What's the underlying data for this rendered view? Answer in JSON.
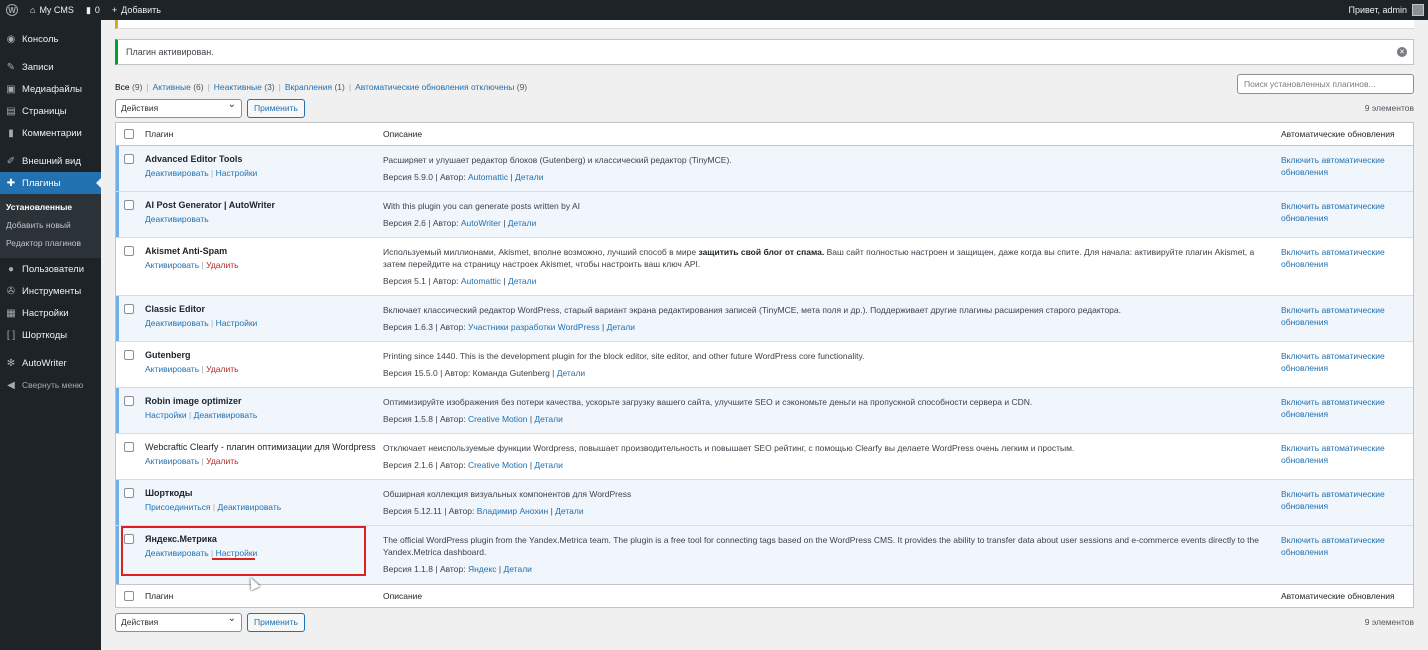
{
  "adminbar": {
    "site_name": "My CMS",
    "comments_count": "0",
    "add_new": "Добавить",
    "greeting": "Привет, admin"
  },
  "sidebar": {
    "items": [
      {
        "label": "Консоль",
        "icon": "dashboard-icon"
      },
      {
        "label": "Записи",
        "icon": "pin-icon"
      },
      {
        "label": "Медиафайлы",
        "icon": "media-icon"
      },
      {
        "label": "Страницы",
        "icon": "page-icon"
      },
      {
        "label": "Комментарии",
        "icon": "comment-icon"
      },
      {
        "label": "Внешний вид",
        "icon": "brush-icon"
      },
      {
        "label": "Плагины",
        "icon": "plugin-icon"
      },
      {
        "label": "Пользователи",
        "icon": "user-icon"
      },
      {
        "label": "Инструменты",
        "icon": "wrench-icon"
      },
      {
        "label": "Настройки",
        "icon": "settings-icon"
      },
      {
        "label": "Шорткоды",
        "icon": "brackets-icon"
      },
      {
        "label": "AutoWriter",
        "icon": "gear-icon"
      },
      {
        "label": "Свернуть меню",
        "icon": "collapse-icon"
      }
    ],
    "submenu": [
      "Установленные",
      "Добавить новый",
      "Редактор плагинов"
    ]
  },
  "notice": {
    "text": "Плагин активирован."
  },
  "filters": {
    "all": "Все",
    "all_count": "(9)",
    "active": "Активные",
    "active_count": "(6)",
    "inactive": "Неактивные",
    "inactive_count": "(3)",
    "dropins": "Вкрапления",
    "dropins_count": "(1)",
    "autoupdates": "Автоматические обновления отключены",
    "autoupdates_count": "(9)"
  },
  "search": {
    "placeholder": "Поиск установленных плагинов..."
  },
  "bulk": {
    "select": "Действия",
    "apply": "Применить",
    "count": "9 элементов"
  },
  "table": {
    "col_plugin": "Плагин",
    "col_desc": "Описание",
    "col_auto": "Автоматические обновления",
    "auto_label": "Включить автоматические обновления",
    "rows": [
      {
        "name": "Advanced Editor Tools",
        "actions": [
          "Деактивировать",
          "Настройки"
        ],
        "desc": "Расширяет и улушает редактор блоков (Gutenberg) и классический редактор (TinyMCE).",
        "version": "Версия 5.9.0",
        "author_prefix": "Автор:",
        "author": "Automattic",
        "details": "Детали"
      },
      {
        "name": "AI Post Generator | AutoWriter",
        "actions": [
          "Деактивировать"
        ],
        "desc": "With this plugin you can generate posts written by AI",
        "version": "Версия 2.6",
        "author_prefix": "Автор:",
        "author": "AutoWriter",
        "details": "Детали"
      },
      {
        "name": "Akismet Anti-Spam",
        "actions": [
          "Активировать",
          "Удалить"
        ],
        "desc_a": "Используемый миллионами, Akismet, вполне возможно, лучший способ в мире",
        "desc_b": "защитить свой блог от спама.",
        "desc_c": "Ваш сайт полностью настроен и защищен, даже когда вы спите. Для начала: активируйте плагин Akismet, а затем перейдите на страницу настроек Akismet, чтобы настроить ваш ключ API.",
        "version": "Версия 5.1",
        "author_prefix": "Автор:",
        "author": "Automattic",
        "details": "Детали"
      },
      {
        "name": "Classic Editor",
        "actions": [
          "Деактивировать",
          "Настройки"
        ],
        "desc": "Включает классический редактор WordPress, старый вариант экрана редактирования записей (TinyMCE, мета поля и др.). Поддерживает другие плагины расширения старого редактора.",
        "version": "Версия 1.6.3",
        "author_prefix": "Автор:",
        "author": "Участники разработки WordPress",
        "details": "Детали"
      },
      {
        "name": "Gutenberg",
        "actions": [
          "Активировать",
          "Удалить"
        ],
        "desc": "Printing since 1440. This is the development plugin for the block editor, site editor, and other future WordPress core functionality.",
        "version": "Версия 15.5.0",
        "author_prefix": "Автор: Команда Gutenberg",
        "author": "",
        "details": "Детали"
      },
      {
        "name": "Robin image optimizer",
        "actions": [
          "Настройки",
          "Деактивировать"
        ],
        "desc": "Оптимизируйте изображения без потери качества, ускорьте загрузку вашего сайта, улучшите SEO и сэкономьте деньги на пропускной способности сервера и CDN.",
        "version": "Версия 1.5.8",
        "author_prefix": "Автор:",
        "author": "Creative Motion",
        "details": "Детали"
      },
      {
        "name": "Webcraftic Clearfy - плагин оптимизации для Wordpress",
        "actions": [
          "Активировать",
          "Удалить"
        ],
        "desc": "Отключает неиспользуемые функции Wordpress, повышает производительность и повышает SEO рейтинг, с помощью Clearfy вы делаете WordPress очень легким и простым.",
        "version": "Версия 2.1.6",
        "author_prefix": "Автор:",
        "author": "Creative Motion",
        "details": "Детали"
      },
      {
        "name": "Шорткоды",
        "actions": [
          "Присоединиться",
          "Деактивировать"
        ],
        "desc": "Обширная коллекция визуальных компонентов для WordPress",
        "version": "Версия 5.12.11",
        "author_prefix": "Автор:",
        "author": "Владимир Анохин",
        "details": "Детали"
      },
      {
        "name": "Яндекс.Метрика",
        "actions": [
          "Деактивировать",
          "Настройки"
        ],
        "desc": "The official WordPress plugin from the Yandex.Metrica team. The plugin is a free tool for connecting tags based on the WordPress CMS. It provides the ability to transfer data about user sessions and e-commerce events directly to the Yandex.Metrica dashboard.",
        "version": "Версия 1.1.8",
        "author_prefix": "Автор:",
        "author": "Яндекс",
        "details": "Детали"
      }
    ]
  }
}
